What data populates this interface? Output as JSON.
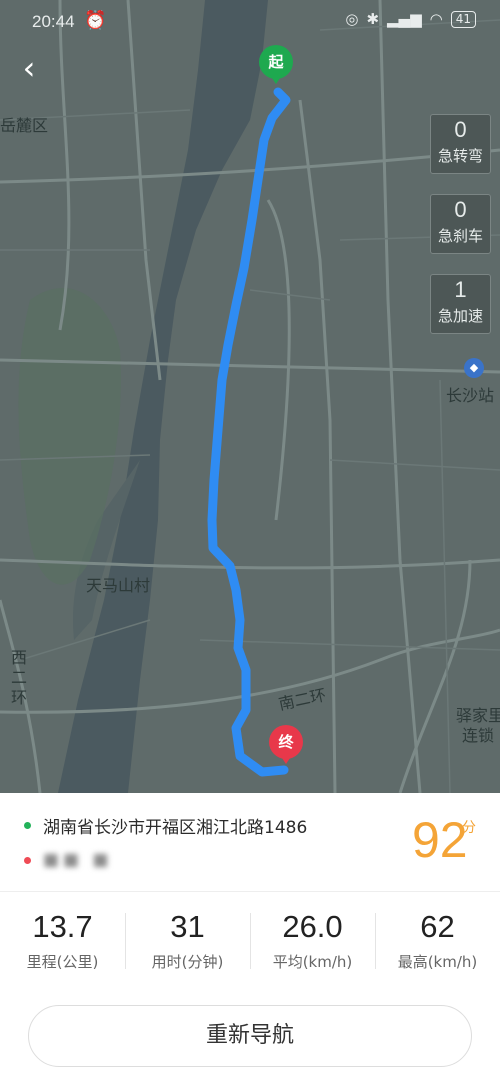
{
  "status_bar": {
    "time": "20:44",
    "battery": "41"
  },
  "map": {
    "labels": {
      "district_left": "岳麓区",
      "station": "长沙站",
      "tianmashan": "天马山村",
      "ring_road": "南二环",
      "west_ring": "西二环",
      "yijia_line1": "驿家里",
      "yijia_line2": "连锁"
    },
    "driving_events": [
      {
        "count": "0",
        "label": "急转弯"
      },
      {
        "count": "0",
        "label": "急刹车"
      },
      {
        "count": "1",
        "label": "急加速"
      }
    ],
    "start_pin": "起",
    "end_pin": "终",
    "colors": {
      "route": "#2f8cf3",
      "start": "#1ea94f",
      "end": "#e8384a"
    }
  },
  "trip": {
    "start_address": "湖南省长沙市开福区湘江北路1486",
    "end_address_blurred": "■■ ■",
    "score": "92",
    "score_unit": "分",
    "metrics": [
      {
        "value": "13.7",
        "label": "里程(公里)"
      },
      {
        "value": "31",
        "label": "用时(分钟)"
      },
      {
        "value": "26.0",
        "label": "平均(km/h)"
      },
      {
        "value": "62",
        "label": "最高(km/h)"
      }
    ],
    "renavigate_label": "重新导航"
  }
}
